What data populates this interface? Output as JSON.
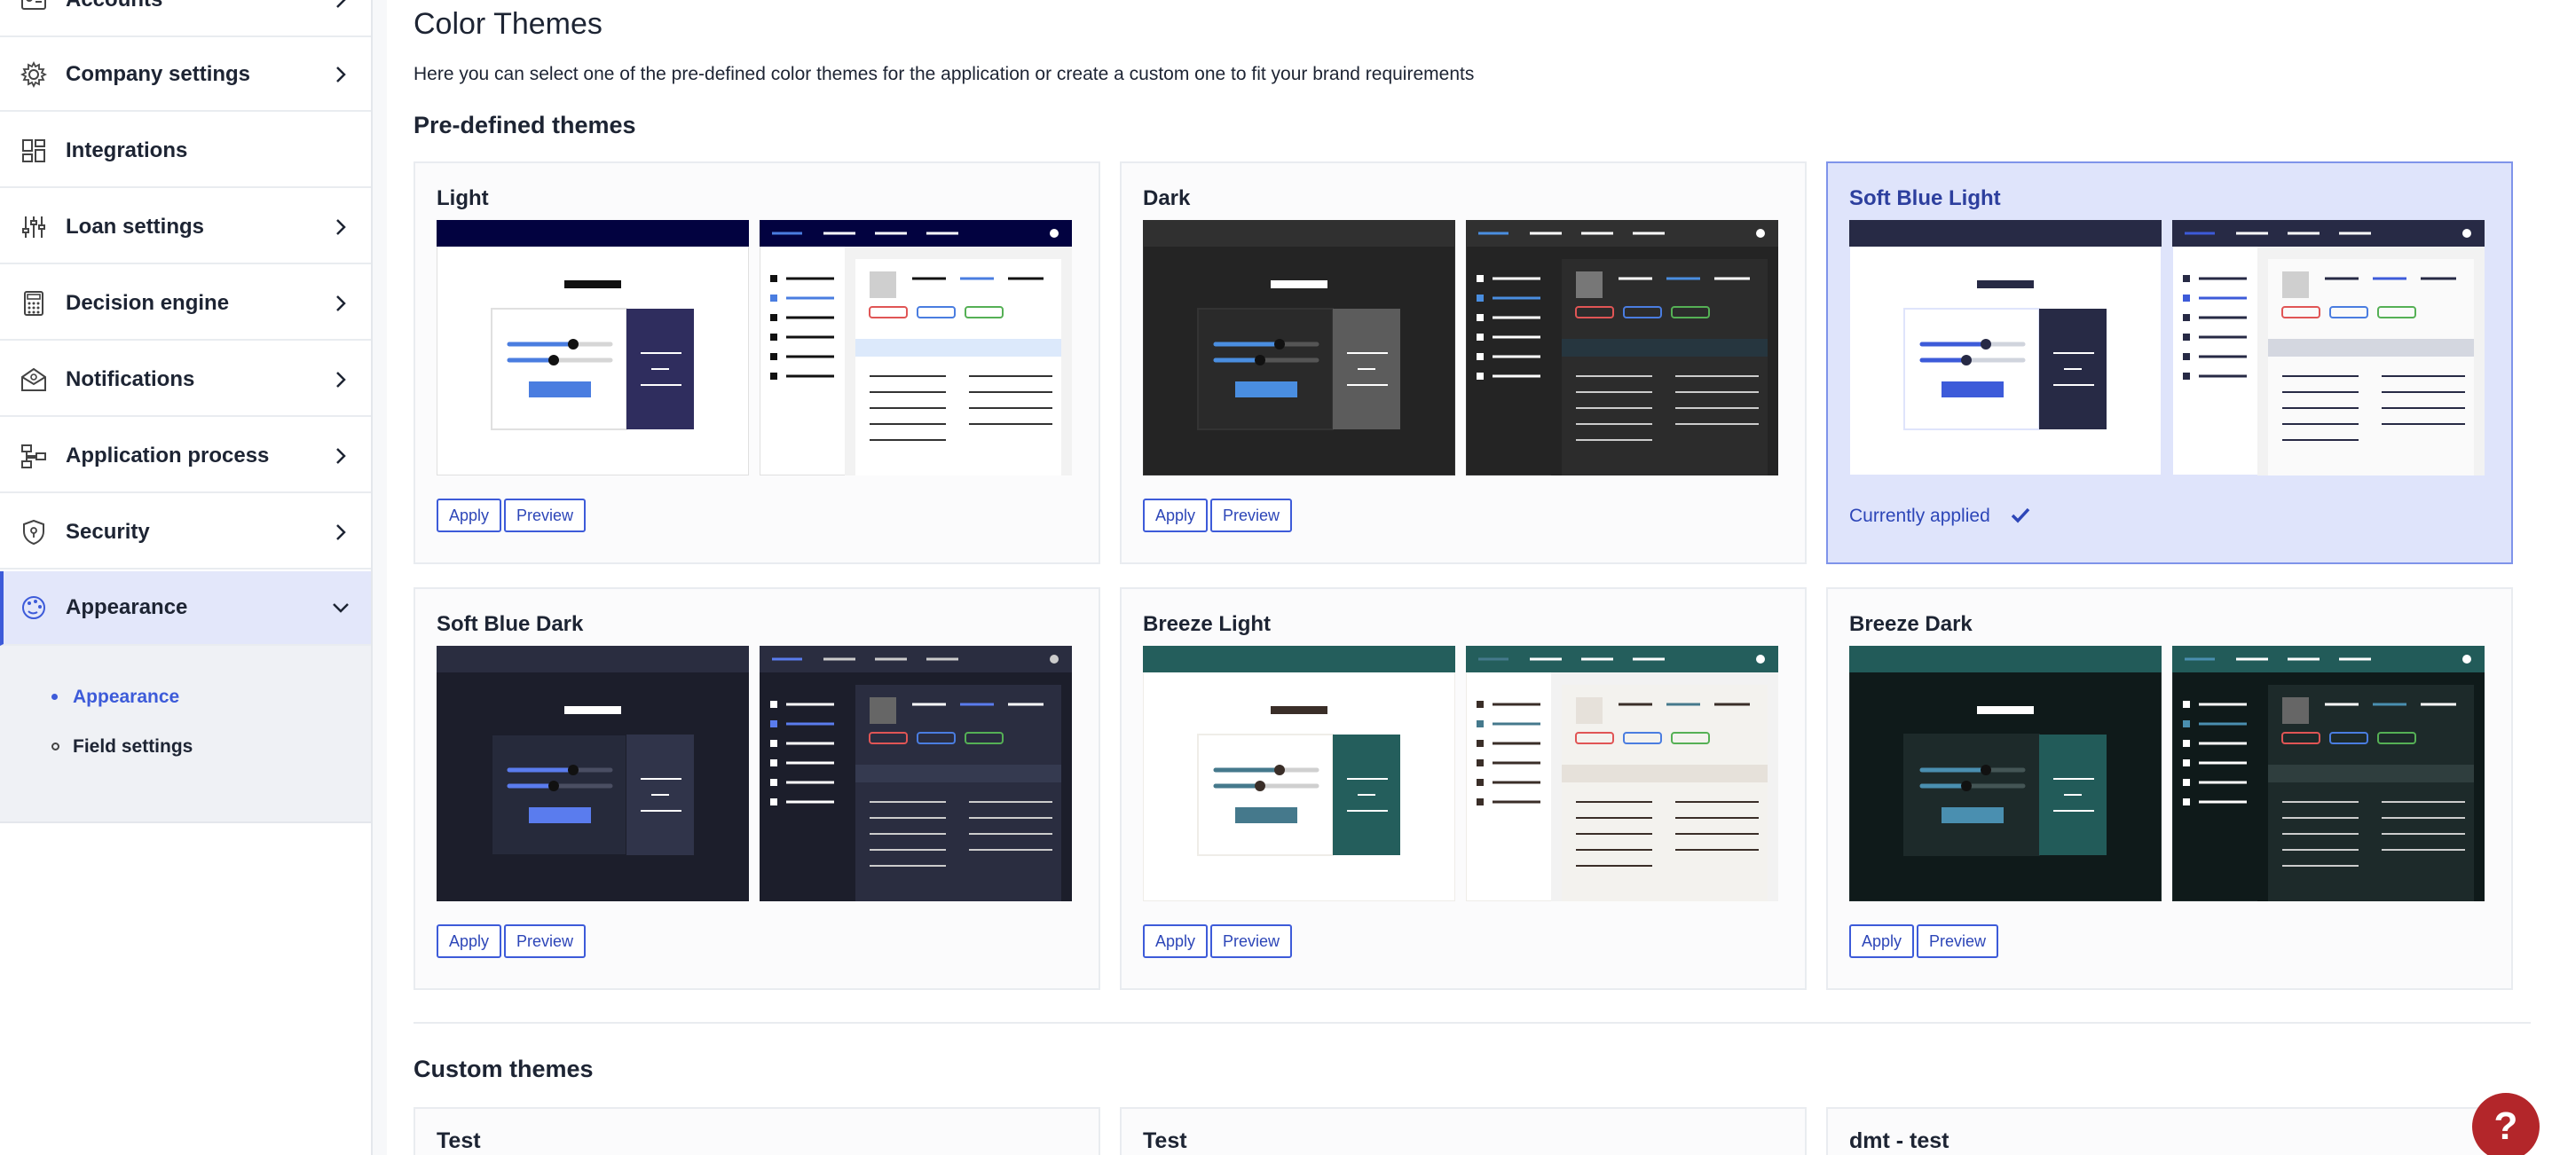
{
  "sidebar": {
    "items": [
      {
        "label": "Accounts",
        "icon": "id-card-icon"
      },
      {
        "label": "Company settings",
        "icon": "gear-icon"
      },
      {
        "label": "Integrations",
        "icon": "grid-icon"
      },
      {
        "label": "Loan settings",
        "icon": "sliders-icon"
      },
      {
        "label": "Decision engine",
        "icon": "calculator-icon"
      },
      {
        "label": "Notifications",
        "icon": "envelope-icon"
      },
      {
        "label": "Application process",
        "icon": "workflow-icon"
      },
      {
        "label": "Security",
        "icon": "shield-icon"
      },
      {
        "label": "Appearance",
        "icon": "palette-icon"
      }
    ],
    "subitems": [
      {
        "label": "Appearance",
        "active": true
      },
      {
        "label": "Field settings",
        "active": false
      }
    ]
  },
  "main": {
    "title": "Color Themes",
    "description": "Here you can select one of the pre-defined color themes for the application or create a custom one to fit your brand requirements",
    "predefined_title": "Pre-defined themes",
    "custom_title": "Custom themes",
    "apply_label": "Apply",
    "preview_label": "Preview",
    "currently_applied_label": "Currently applied",
    "themes": [
      {
        "name": "Light"
      },
      {
        "name": "Dark"
      },
      {
        "name": "Soft Blue Light"
      },
      {
        "name": "Soft Blue Dark"
      },
      {
        "name": "Breeze Light"
      },
      {
        "name": "Breeze Dark"
      }
    ],
    "custom_themes": [
      {
        "name": "Test"
      },
      {
        "name": "Test"
      },
      {
        "name": "dmt - test"
      }
    ]
  },
  "help": {
    "label": "?"
  },
  "colors": {
    "accent": "#3d5bd9",
    "help": "#b3262a",
    "applied_bg": "#dfe4fb"
  }
}
